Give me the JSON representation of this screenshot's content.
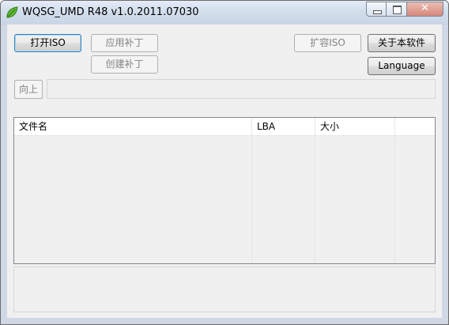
{
  "window": {
    "title": "WQSG_UMD R48 v1.0.2011.07030",
    "icon": "leaf-icon",
    "controls": {
      "minimize": "minimize-icon",
      "maximize": "maximize-icon",
      "close": "close-icon"
    }
  },
  "toolbar": {
    "open_iso": "打开ISO",
    "apply_patch": "应用补丁",
    "create_patch": "创建补丁",
    "expand_iso": "扩容ISO",
    "about": "关于本软件",
    "language": "Language",
    "up": "向上"
  },
  "path": {
    "value": ""
  },
  "file_list": {
    "columns": [
      "文件名",
      "LBA",
      "大小",
      ""
    ],
    "rows": []
  },
  "status": {
    "text": ""
  },
  "colors": {
    "titlebar": "#d3deec",
    "client": "#f0f0f0",
    "default_button_border": "#3c7fb1"
  }
}
